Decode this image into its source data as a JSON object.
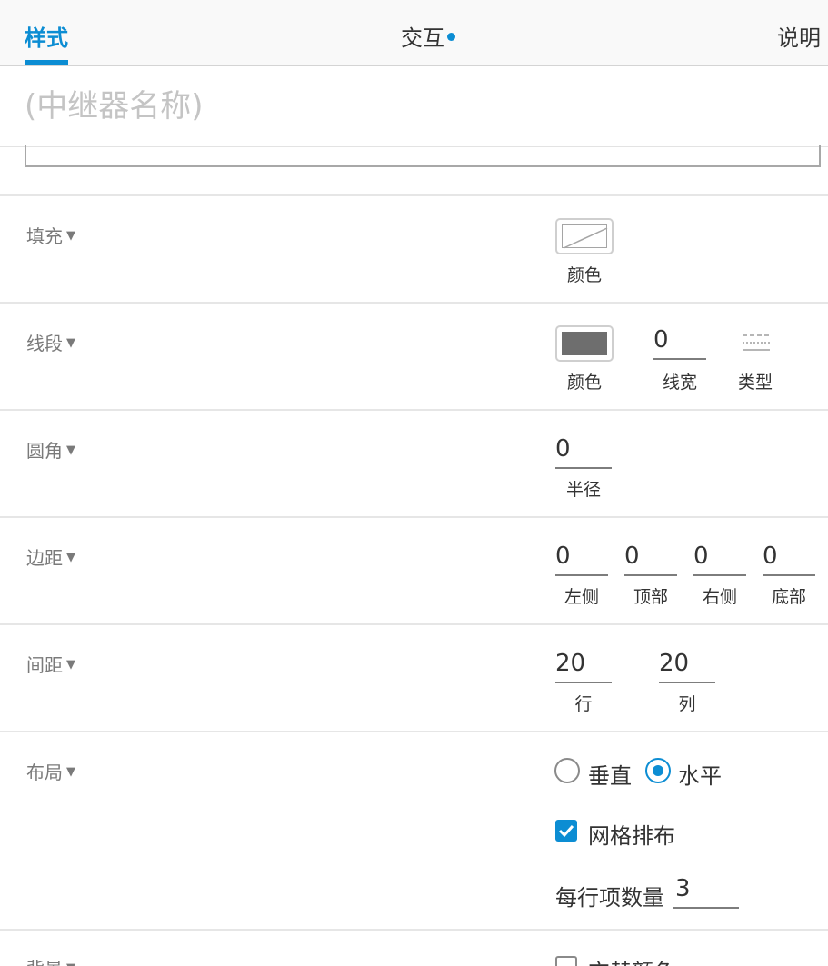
{
  "tabs": {
    "style": "样式",
    "interact": "交互",
    "desc": "说明"
  },
  "name_field": {
    "placeholder": "(中继器名称)"
  },
  "sections": {
    "fill": {
      "label": "填充",
      "color_caption": "颜色"
    },
    "stroke": {
      "label": "线段",
      "color_caption": "颜色",
      "width_value": "0",
      "width_caption": "线宽",
      "type_caption": "类型"
    },
    "corner": {
      "label": "圆角",
      "radius_value": "0",
      "radius_caption": "半径"
    },
    "padding": {
      "label": "边距",
      "left_value": "0",
      "left_caption": "左侧",
      "top_value": "0",
      "top_caption": "顶部",
      "right_value": "0",
      "right_caption": "右侧",
      "bottom_value": "0",
      "bottom_caption": "底部"
    },
    "spacing": {
      "label": "间距",
      "row_value": "20",
      "row_caption": "行",
      "col_value": "20",
      "col_caption": "列"
    },
    "layout": {
      "label": "布局",
      "vertical": "垂直",
      "horizontal": "水平",
      "selected": "水平",
      "grid_label": "网格排布",
      "grid_checked": true,
      "items_per_row_label": "每行项数量",
      "items_per_row_value": "3"
    },
    "background": {
      "label": "背景",
      "alt_color_label": "交替颜色",
      "alt_checked": false
    }
  },
  "caret_glyph": "▼",
  "colors": {
    "accent": "#0c8dd3",
    "stroke_swatch": "#6e6e6e"
  }
}
